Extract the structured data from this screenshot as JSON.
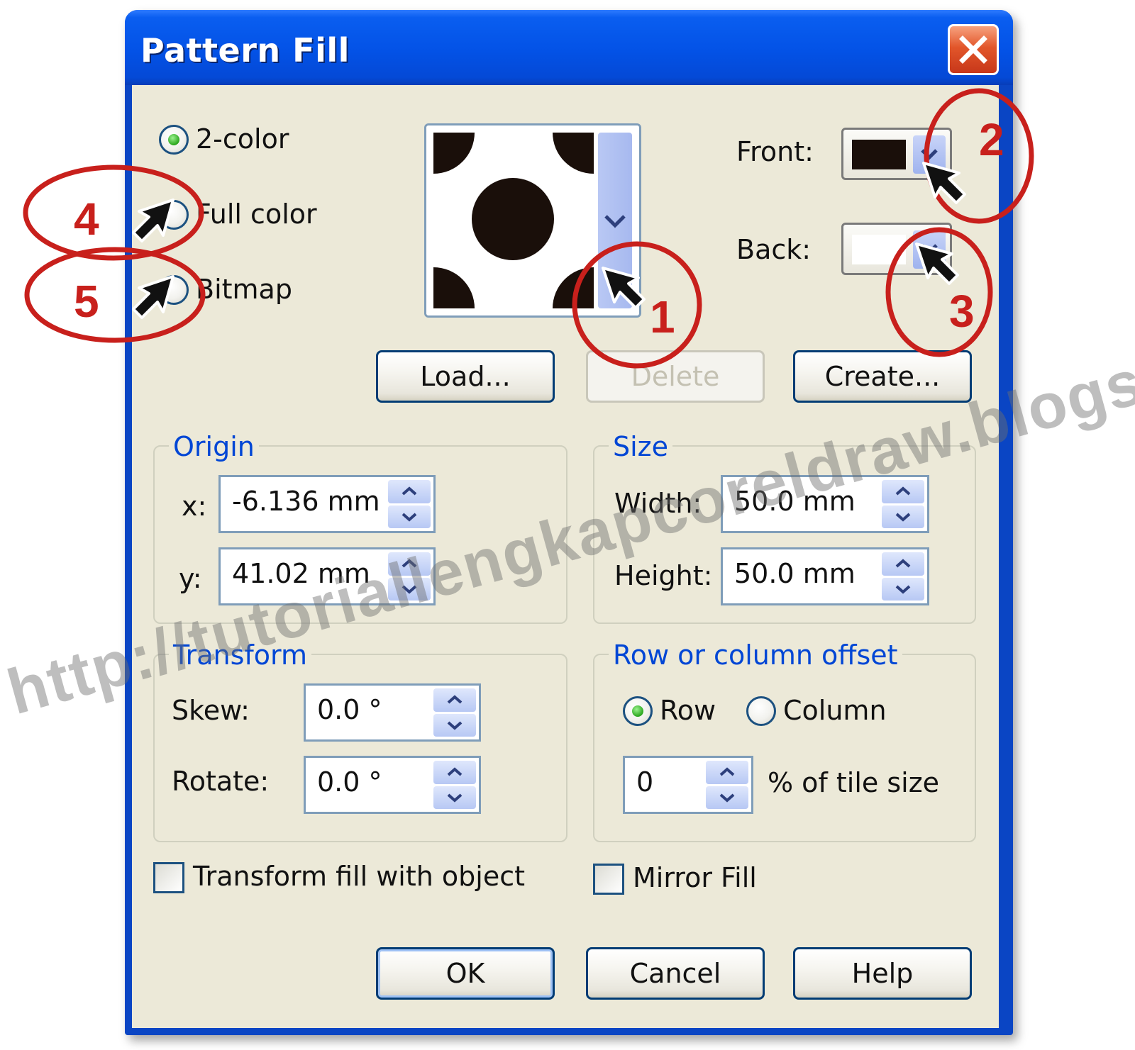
{
  "window": {
    "title": "Pattern Fill",
    "close_icon": "close-icon"
  },
  "pattern_type": {
    "options": [
      "2-color",
      "Full color",
      "Bitmap"
    ],
    "selected": "2-color"
  },
  "colors": {
    "front_label": "Front:",
    "front_color": "#1a0f0a",
    "back_label": "Back:",
    "back_color": "#ffffff"
  },
  "pattern_buttons": {
    "load": "Load...",
    "delete": "Delete",
    "create": "Create..."
  },
  "origin": {
    "title": "Origin",
    "x_label": "x:",
    "x_value": "-6.136 mm",
    "y_label": "y:",
    "y_value": "41.02 mm"
  },
  "size": {
    "title": "Size",
    "width_label": "Width:",
    "width_value": "50.0 mm",
    "height_label": "Height:",
    "height_value": "50.0 mm"
  },
  "transform": {
    "title": "Transform",
    "skew_label": "Skew:",
    "skew_value": "0.0 °",
    "rotate_label": "Rotate:",
    "rotate_value": "0.0 °"
  },
  "offset": {
    "title": "Row or column offset",
    "row_label": "Row",
    "column_label": "Column",
    "selected": "Row",
    "value": "0",
    "unit_label": "% of tile size"
  },
  "options": {
    "transform_fill_label": "Transform fill with object",
    "transform_fill_checked": false,
    "mirror_fill_label": "Mirror Fill",
    "mirror_fill_checked": false
  },
  "footer": {
    "ok": "OK",
    "cancel": "Cancel",
    "help": "Help"
  },
  "annotations": {
    "numbers": [
      "1",
      "2",
      "3",
      "4",
      "5"
    ],
    "color": "#c8201c"
  },
  "watermark": "http://tutoriallengkapcoreldraw.blogspot.com/"
}
